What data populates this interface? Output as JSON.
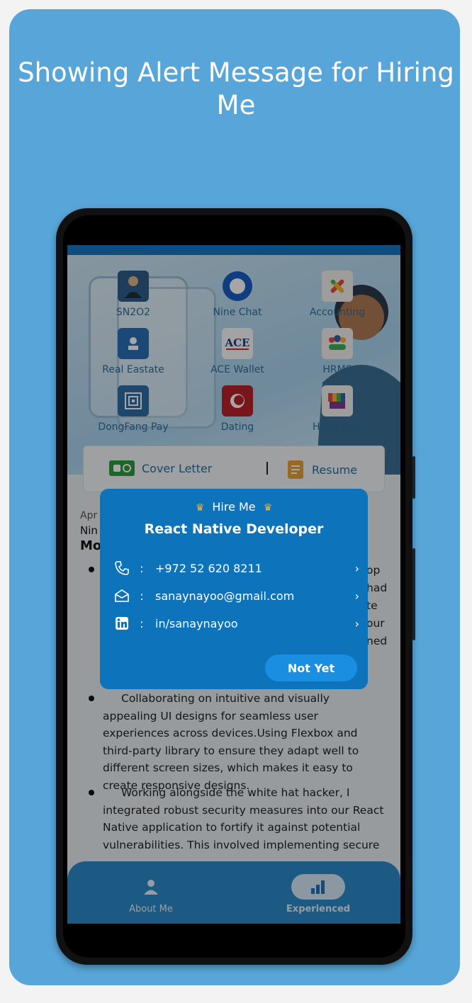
{
  "headline": "Showing Alert Message for Hiring Me",
  "apps": [
    {
      "label": "SN2O2",
      "icon": "profile-photo-icon"
    },
    {
      "label": "Nine Chat",
      "icon": "chat-bubble-icon"
    },
    {
      "label": "Accounting",
      "icon": "accounting-icon"
    },
    {
      "label": "Real Eastate",
      "icon": "real-estate-icon"
    },
    {
      "label": "ACE Wallet",
      "icon": "ace-wallet-icon"
    },
    {
      "label": "HRMS",
      "icon": "people-icon"
    },
    {
      "label": "DongFang Pay",
      "icon": "pay-pattern-icon"
    },
    {
      "label": "Dating",
      "icon": "dating-icon"
    },
    {
      "label": "Hotel POS",
      "icon": "shop-awning-icon"
    }
  ],
  "buttons": {
    "cover_letter": "Cover Letter",
    "resume": "Resume"
  },
  "meta": {
    "date_prefix": "Apr",
    "company_prefix": "Nin",
    "role_prefix": "Mo"
  },
  "peek_fragments": [
    "op",
    "had",
    "te",
    "our",
    "ned"
  ],
  "paragraphs": [
    "Collaborating on intuitive and visually appealing UI designs for seamless user experiences across devices.Using Flexbox and third-party library to ensure they adapt well to different screen sizes, which makes it easy to create responsive designs.",
    "Working alongside the white hat hacker, I integrated robust security measures into our React Native application to fortify it against potential vulnerabilities. This involved implementing secure"
  ],
  "tabs": [
    {
      "label": "About Me",
      "icon": "person-icon",
      "active": false
    },
    {
      "label": "Experienced",
      "icon": "bar-chart-icon",
      "active": true
    }
  ],
  "modal": {
    "subtitle": "Hire Me",
    "title": "React Native Developer",
    "contacts": [
      {
        "icon": "phone-icon",
        "value": "+972 52 620 8211"
      },
      {
        "icon": "email-icon",
        "value": "sanaynayoo@gmail.com"
      },
      {
        "icon": "linkedin-icon",
        "value": "in/sanaynayoo"
      }
    ],
    "colon": ":",
    "dismiss_label": "Not Yet"
  },
  "colors": {
    "background": "#58a6d9",
    "modal": "#0d73bb",
    "button": "#1a8ee0",
    "crown": "#f5b52e"
  }
}
